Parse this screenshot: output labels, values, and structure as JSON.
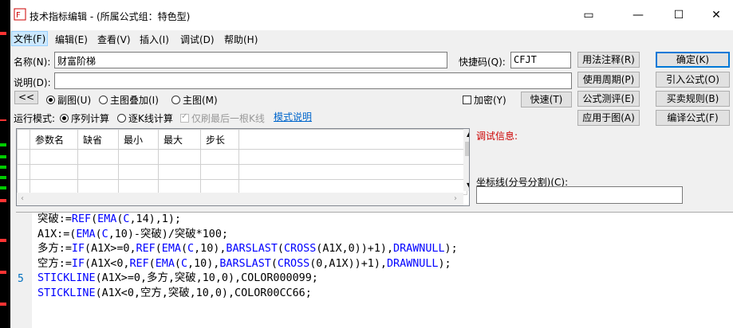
{
  "window": {
    "title": "技术指标编辑 - (所属公式组：特色型)"
  },
  "menu": [
    {
      "label": "文件(F)"
    },
    {
      "label": "编辑(E)"
    },
    {
      "label": "查看(V)"
    },
    {
      "label": "插入(I)"
    },
    {
      "label": "调试(D)"
    },
    {
      "label": "帮助(H)"
    }
  ],
  "form": {
    "name_label": "名称(N):",
    "name_value": "财富阶梯",
    "desc_label": "说明(D):",
    "desc_value": "",
    "shortcut_label": "快捷码(Q):",
    "shortcut_value": "CFJT",
    "collapse_label": "<<",
    "radio_sub": "副图(U)",
    "radio_overlay": "主图叠加(I)",
    "radio_main": "主图(M)",
    "encrypt_label": "加密(Y)",
    "run_mode_label": "运行模式:",
    "radio_seq": "序列计算",
    "radio_bar": "逐K线计算",
    "refresh_last": "仅刷最后一根K线",
    "mode_link": "模式说明",
    "debug_label": "调试信息:",
    "coord_label": "坐标线(分号分割)(C):",
    "coord_value": ""
  },
  "buttons": {
    "quick": "快速(T)",
    "syntax": "用法注释(R)",
    "ok": "确定(K)",
    "period": "使用周期(P)",
    "import": "引入公式(O)",
    "test": "公式测评(E)",
    "rules": "买卖规则(B)",
    "apply": "应用于图(A)",
    "compile": "编译公式(F)"
  },
  "params_table": {
    "headers": [
      "参数名",
      "缺省",
      "最小",
      "最大",
      "步长"
    ]
  },
  "editor": {
    "line_number": "5",
    "lines": [
      "突破:=REF(EMA(C,14),1);",
      "A1X:=(EMA(C,10)-突破)/突破*100;",
      "多方:=IF(A1X>=0,REF(EMA(C,10),BARSLAST(CROSS(A1X,0))+1),DRAWNULL);",
      "空方:=IF(A1X<0,REF(EMA(C,10),BARSLAST(CROSS(0,A1X))+1),DRAWNULL);",
      "STICKLINE(A1X>=0,多方,突破,10,0),COLOR000099;",
      "STICKLINE(A1X<0,空方,突破,10,0),COLOR00CC66;"
    ]
  },
  "colors": {
    "accent": "#0078d7",
    "keyword": "#0000ff",
    "debug": "#cc0000",
    "link": "#0066cc"
  }
}
